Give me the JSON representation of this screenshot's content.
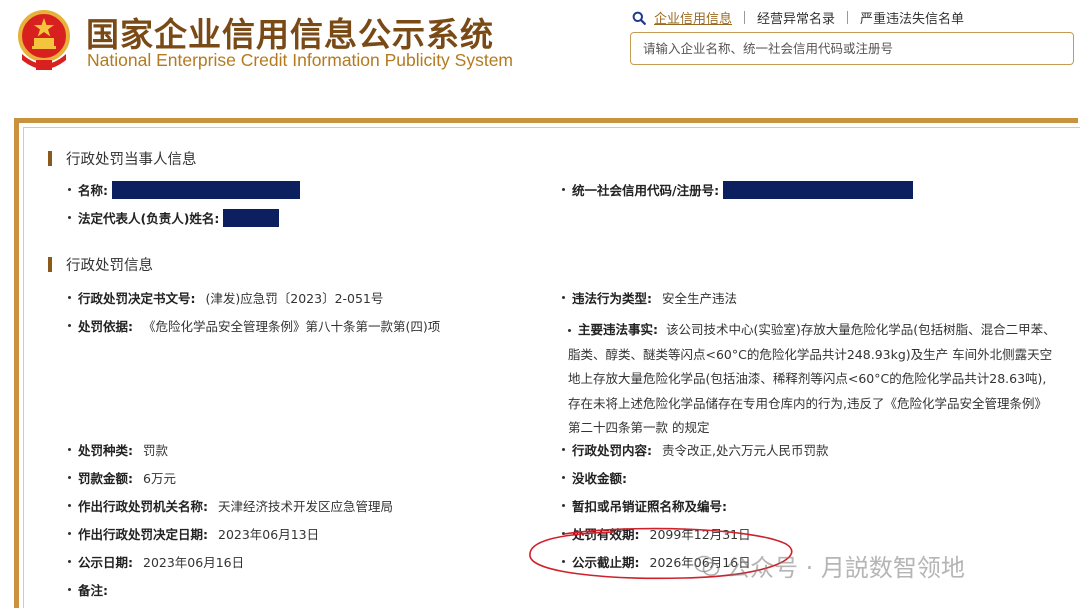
{
  "header": {
    "title_cn": "国家企业信用信息公示系统",
    "title_en": "National Enterprise Credit Information Publicity System",
    "nav": {
      "enterprise_info": "企业信用信息",
      "abnormal_list": "经营异常名录",
      "blacklist": "严重违法失信名单"
    },
    "search": {
      "placeholder": "请输入企业名称、统一社会信用代码或注册号"
    },
    "icons": {
      "emblem": "national-emblem-icon",
      "search": "search-icon"
    },
    "colors": {
      "title": "#7a4a16",
      "subtitle": "#b57a1f",
      "accent": "#c9923e"
    }
  },
  "party_section": {
    "title": "行政处罚当事人信息",
    "name_label": "名称:",
    "credit_code_label": "统一社会信用代码/注册号:",
    "legal_rep_label": "法定代表人(负责人)姓名:"
  },
  "penalty_section": {
    "title": "行政处罚信息",
    "decision_no_label": "行政处罚决定书文号:",
    "decision_no": "(津发)应急罚〔2023〕2-051号",
    "violation_type_label": "违法行为类型:",
    "violation_type": "安全生产违法",
    "basis_label": "处罚依据:",
    "basis": "《危险化学品安全管理条例》第八十条第一款第(四)项",
    "main_facts_label": "主要违法事实:",
    "main_facts": "该公司技术中心(实验室)存放大量危险化学品(包括树脂、混合二甲苯、脂类、醇类、醚类等闪点<60°C的危险化学品共计248.93kg)及生产 车间外北侧露天空地上存放大量危险化学品(包括油漆、稀释剂等闪点<60°C的危险化学品共计28.63吨),存在未将上述危险化学品储存在专用仓库内的行为,违反了《危险化学品安全管理条例》第二十四条第一款 的规定",
    "penalty_kind_label": "处罚种类:",
    "penalty_kind": "罚款",
    "penalty_content_label": "行政处罚内容:",
    "penalty_content": "责令改正,处六万元人民币罚款",
    "fine_amount_label": "罚款金额:",
    "fine_amount": "6万元",
    "confiscation_label": "没收金额:",
    "confiscation": "",
    "authority_label": "作出行政处罚机关名称:",
    "authority": "天津经济技术开发区应急管理局",
    "license_label": "暂扣或吊销证照名称及编号:",
    "license": "",
    "decision_date_label": "作出行政处罚决定日期:",
    "decision_date": "2023年06月13日",
    "validity_label": "处罚有效期:",
    "validity": "2099年12月31日",
    "publicity_date_label": "公示日期:",
    "publicity_date": "2023年06月16日",
    "publicity_end_label": "公示截止期:",
    "publicity_end": "2026年06月16日",
    "remarks_label": "备注:",
    "remarks": ""
  },
  "watermark": {
    "text": "公众号 · 月説数智领地",
    "icon": "wechat-icon"
  },
  "colors": {
    "redaction": "#0c1f5e",
    "annotation_circle": "#d0202a",
    "section_bar": "#8a5a1c"
  }
}
